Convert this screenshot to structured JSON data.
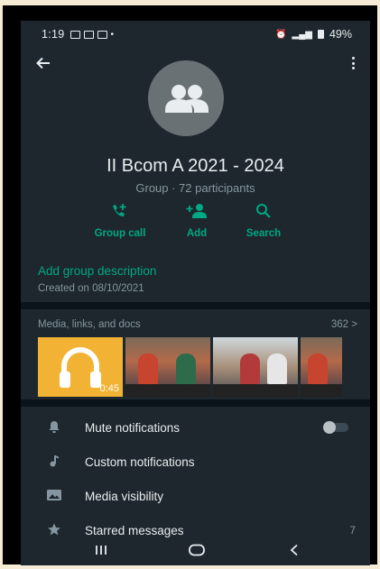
{
  "status_bar": {
    "time": "1:19",
    "battery": "49%"
  },
  "group": {
    "name": "II Bcom A 2021 - 2024",
    "subtitle": "Group · 72 participants"
  },
  "actions": [
    {
      "label": "Group call",
      "icon": "add-call-icon"
    },
    {
      "label": "Add",
      "icon": "add-person-icon"
    },
    {
      "label": "Search",
      "icon": "search-icon"
    }
  ],
  "description": {
    "title": "Add group description",
    "created": "Created on 08/10/2021"
  },
  "media": {
    "title": "Media, links, and docs",
    "count": "362 >",
    "audio_duration": "0:45"
  },
  "settings": [
    {
      "label": "Mute notifications",
      "icon": "bell-icon"
    },
    {
      "label": "Custom notifications",
      "icon": "music-note-icon"
    },
    {
      "label": "Media visibility",
      "icon": "image-icon"
    },
    {
      "label": "Starred messages",
      "icon": "star-icon",
      "value": "7"
    }
  ],
  "colors": {
    "accent": "#00a884",
    "background": "#0b141a",
    "surface": "#1d272d"
  }
}
